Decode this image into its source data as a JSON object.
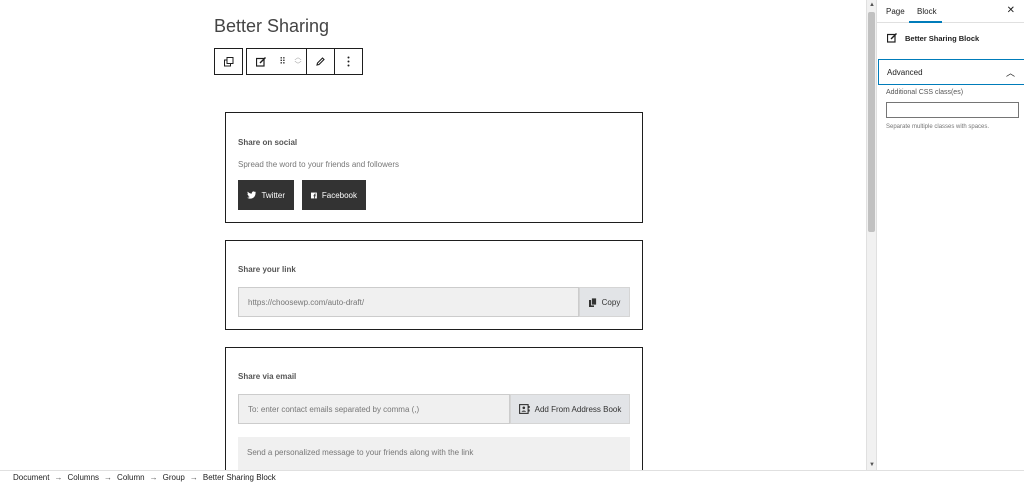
{
  "post_title": "Better Sharing",
  "social_card": {
    "title": "Share on social",
    "subtitle": "Spread the word to your friends and followers",
    "twitter_label": "Twitter",
    "facebook_label": "Facebook"
  },
  "link_card": {
    "title": "Share your link",
    "url": "https://choosewp.com/auto-draft/",
    "copy_label": "Copy"
  },
  "email_card": {
    "title": "Share via email",
    "to_placeholder": "To: enter contact emails separated by comma (,)",
    "address_book_label": "Add From Address Book",
    "message_placeholder": "Send a personalized message to your friends along with the link"
  },
  "sidebar": {
    "tab_page": "Page",
    "tab_block": "Block",
    "close": "✕",
    "block_name": "Better Sharing Block",
    "advanced_label": "Advanced",
    "css_label": "Additional CSS class(es)",
    "css_help": "Separate multiple classes with spaces."
  },
  "breadcrumb": [
    "Document",
    "Columns",
    "Column",
    "Group",
    "Better Sharing Block"
  ],
  "breadcrumb_separator": "→",
  "colors": {
    "accent": "#007cba",
    "dark_button": "#333333"
  }
}
